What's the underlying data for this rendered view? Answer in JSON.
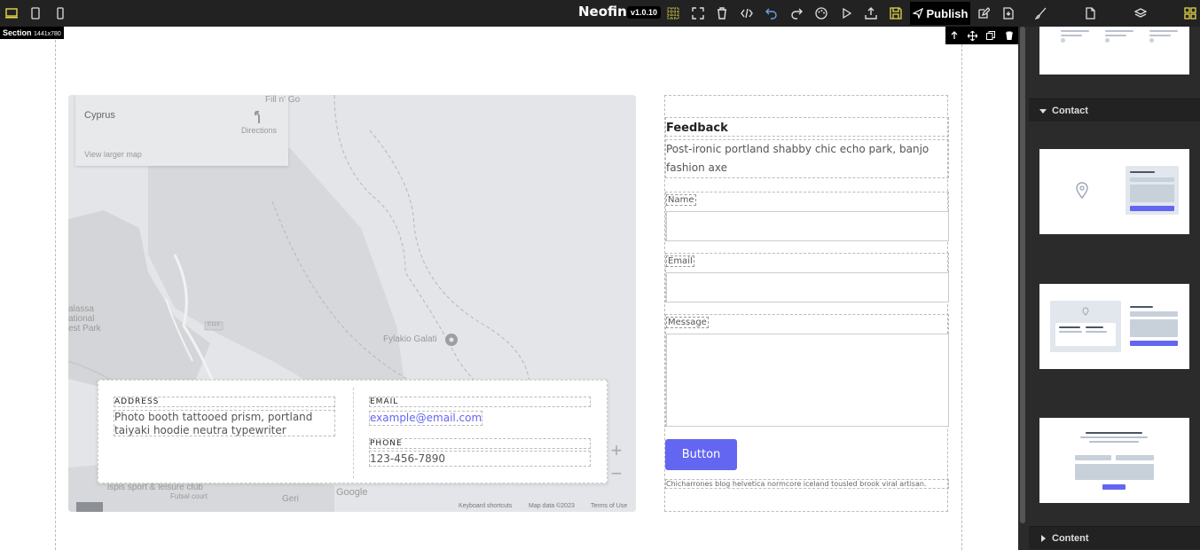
{
  "topbar": {
    "brand": "Neofin",
    "version": "v1.0.10",
    "publish_label": "Publish"
  },
  "canvas": {
    "section_label": "Section",
    "section_size": "1441x780"
  },
  "map": {
    "place": "Cyprus",
    "directions": "Directions",
    "view_larger": "View larger map",
    "labels": [
      "Fill n' Go",
      "Fylakio Galati",
      "E119",
      "alassa",
      "ational",
      "est Park",
      "Geri",
      "ispis sport & leisure club",
      "Futsal court"
    ],
    "google": "Google",
    "keyboard": "Keyboard shortcuts",
    "map_data": "Map data ©2023",
    "terms": "Terms of Use",
    "zoom_in": "+",
    "zoom_out": "−"
  },
  "info": {
    "address_label": "ADDRESS",
    "address_value": "Photo booth tattooed prism, portland taiyaki hoodie neutra typewriter",
    "email_label": "EMAIL",
    "email_value": "example@email.com",
    "phone_label": "PHONE",
    "phone_value": "123-456-7890"
  },
  "form": {
    "title": "Feedback",
    "description": "Post-ironic portland shabby chic echo park, banjo fashion axe",
    "name_label": "Name",
    "email_label": "Email",
    "message_label": "Message",
    "button_label": "Button",
    "note": "Chicharrones blog helvetica normcore iceland tousled brook viral artisan."
  },
  "panel": {
    "contact_heading": "Contact",
    "content_heading": "Content"
  },
  "colors": {
    "accent": "#6366f1",
    "topbar": "#222222",
    "panel": "#2b2b2b"
  }
}
